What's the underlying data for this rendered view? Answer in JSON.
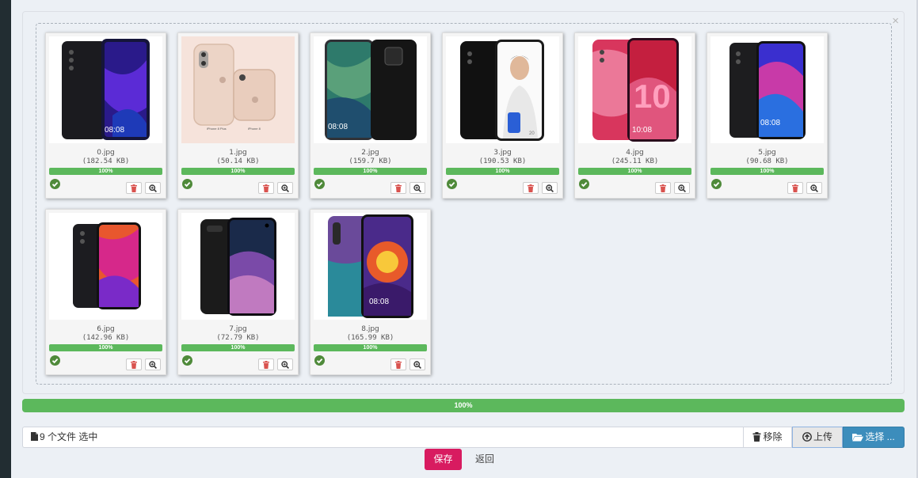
{
  "thumbnails": [
    {
      "name": "0.jpg",
      "size": "(182.54 KB)",
      "progress": "100%",
      "progress_value": 100
    },
    {
      "name": "1.jpg",
      "size": "(50.14 KB)",
      "progress": "100%",
      "progress_value": 100
    },
    {
      "name": "2.jpg",
      "size": "(159.7 KB)",
      "progress": "100%",
      "progress_value": 100
    },
    {
      "name": "3.jpg",
      "size": "(190.53 KB)",
      "progress": "100%",
      "progress_value": 100
    },
    {
      "name": "4.jpg",
      "size": "(245.11 KB)",
      "progress": "100%",
      "progress_value": 100
    },
    {
      "name": "5.jpg",
      "size": "(90.68 KB)",
      "progress": "100%",
      "progress_value": 100
    },
    {
      "name": "6.jpg",
      "size": "(142.96 KB)",
      "progress": "100%",
      "progress_value": 100
    },
    {
      "name": "7.jpg",
      "size": "(72.79 KB)",
      "progress": "100%",
      "progress_value": 100
    },
    {
      "name": "8.jpg",
      "size": "(165.99 KB)",
      "progress": "100%",
      "progress_value": 100
    }
  ],
  "overall_progress": {
    "label": "100%",
    "value": 100
  },
  "file_input": {
    "caption": "9 个文件 选中",
    "caption_icon": "file-icon",
    "remove_label": "移除",
    "remove_icon": "trash-icon",
    "upload_label": "上传",
    "upload_icon": "upload-icon",
    "select_label": "选择 ...",
    "select_icon": "folder-open-icon"
  },
  "form_actions": {
    "save_label": "保存",
    "back_label": "返回"
  },
  "close_label": "×",
  "colors": {
    "page_bg": "#ecf0f5",
    "sidebar": "#222d32",
    "success": "#5cb85c",
    "primary": "#3c8dbc",
    "save": "#d81b60",
    "danger_icon": "#d9534f"
  }
}
